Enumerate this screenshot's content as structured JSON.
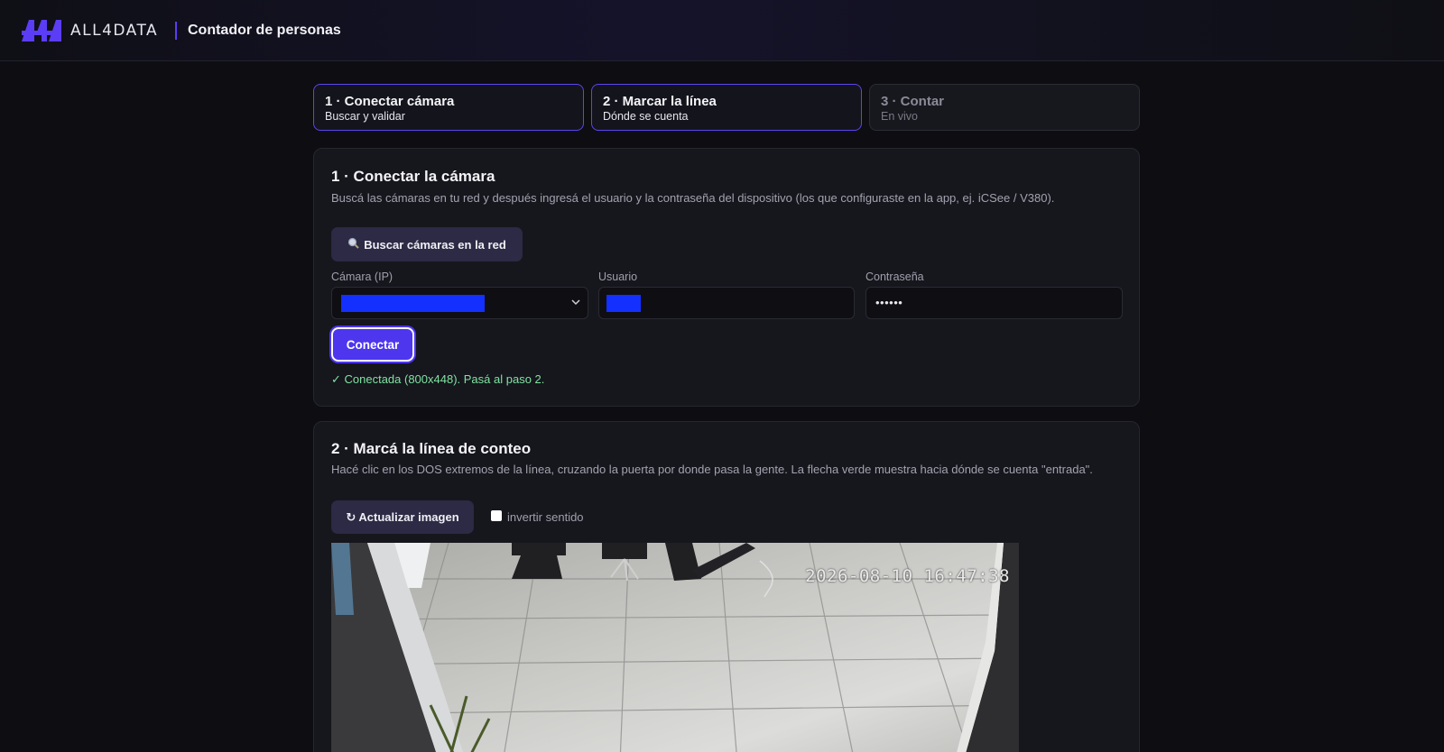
{
  "header": {
    "brand": "ALL4DATA",
    "title": "Contador de personas",
    "accent_color": "#5b3df5"
  },
  "steps": [
    {
      "title": "1 · Conectar cámara",
      "subtitle": "Buscar y validar",
      "state": "active"
    },
    {
      "title": "2 · Marcar la línea",
      "subtitle": "Dónde se cuenta",
      "state": "active"
    },
    {
      "title": "3 · Contar",
      "subtitle": "En vivo",
      "state": "inactive"
    }
  ],
  "connect": {
    "heading": "1 · Conectar la cámara",
    "description": "Buscá las cámaras en tu red y después ingresá el usuario y la contraseña del dispositivo (los que configuraste en la app, ej. iCSee / V380).",
    "search_icon": "magnifier-icon",
    "search_button": "Buscar cámaras en la red",
    "camera_label": "Cámara (IP)",
    "user_label": "Usuario",
    "password_label": "Contraseña",
    "password_value": "••••••",
    "connect_button": "Conectar",
    "status": "✓ Conectada (800x448). Pasá al paso 2."
  },
  "line": {
    "heading": "2 · Marcá la línea de conteo",
    "description": "Hacé clic en los DOS extremos de la línea, cruzando la puerta por donde pasa la gente. La flecha verde muestra hacia dónde se cuenta \"entrada\".",
    "refresh_button": "↻ Actualizar imagen",
    "invert_label": "invertir sentido",
    "invert_checked": false,
    "camera_timestamp": "2026-08-10 16:47:38"
  }
}
